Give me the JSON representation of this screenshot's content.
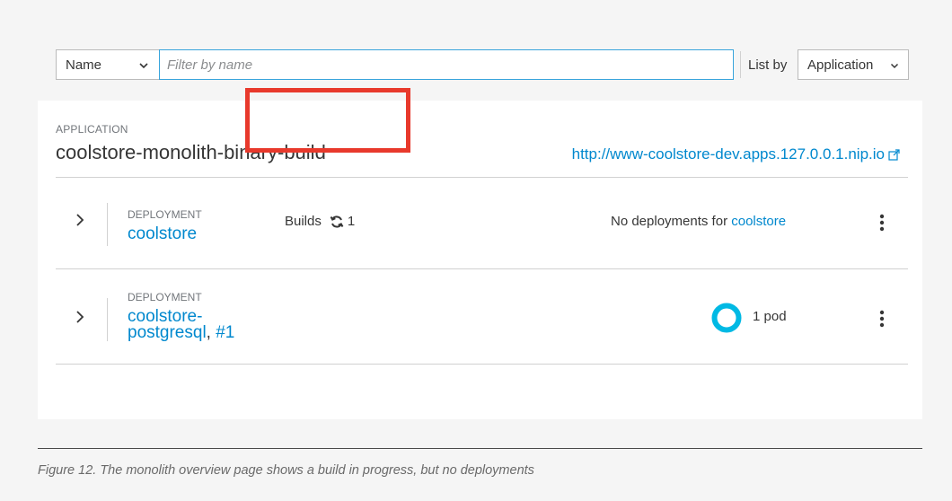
{
  "toolbar": {
    "filter_field": "Name",
    "filter_placeholder": "Filter by name",
    "list_by_label": "List by",
    "list_by_value": "Application"
  },
  "application": {
    "kicker": "APPLICATION",
    "name": "coolstore-monolith-binary-build",
    "route_url": "http://www-coolstore-dev.apps.127.0.0.1.nip.io",
    "deployments": [
      {
        "kicker": "DEPLOYMENT",
        "name": "coolstore",
        "builds_label": "Builds",
        "builds_count": "1",
        "status_text": "No deployments for",
        "status_link": "coolstore"
      },
      {
        "kicker": "DEPLOYMENT",
        "name_line1": "coolstore-",
        "name_line2": "postgresql",
        "revision": "#1",
        "pod_text": "1 pod"
      }
    ]
  },
  "caption": "Figure 12. The monolith overview page shows a build in progress, but no deployments",
  "colors": {
    "link": "#0088ce",
    "highlight": "#e8392c",
    "pod_ring": "#00b9e4",
    "input_focus": "#39a5dc"
  },
  "icons": [
    "chevron-down-icon",
    "external-link-icon",
    "chevron-right-icon",
    "sync-icon",
    "kebab-icon",
    "donut-icon"
  ]
}
